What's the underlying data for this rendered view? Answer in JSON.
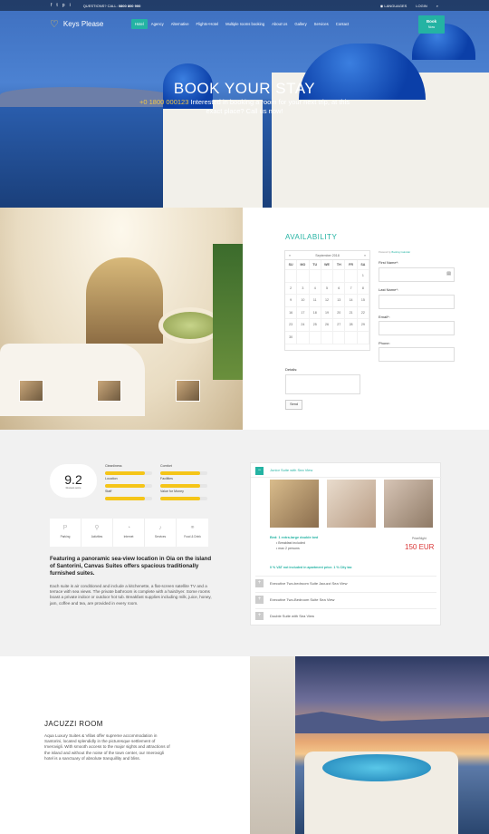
{
  "topbar": {
    "social": [
      "f",
      "t",
      "p",
      "i"
    ],
    "question": "QUESTIONS? CALL:",
    "phone": "0800 800 900",
    "languages": "LANGUAGES",
    "login": "LOGIN"
  },
  "brand": {
    "name": "Keys Please",
    "logo_icon": "heart-key-icon"
  },
  "nav": {
    "items": [
      "Hotel",
      "Agency",
      "Alternative",
      "Flights+Hotel",
      "Multiple rooms booking",
      "About Us",
      "Gallery",
      "Services",
      "Contact"
    ],
    "active": "Hotel",
    "book_now": [
      "Book",
      "Now"
    ]
  },
  "hero": {
    "title": "BOOK YOUR STAY",
    "phone": "+0 1800 000123",
    "subtitle": "Interested in booking a room for your next trip, at this exact place? Call us now!"
  },
  "availability": {
    "title": "AVAILABILITY",
    "powered": "Powered by",
    "powered_brand": "Booking Calendar",
    "month": "September 2018",
    "days": [
      "SU",
      "MO",
      "TU",
      "WE",
      "TH",
      "FR",
      "SA"
    ],
    "dates": [
      "",
      "",
      "",
      "",
      "",
      "",
      "1",
      "2",
      "3",
      "4",
      "5",
      "6",
      "7",
      "8",
      "9",
      "10",
      "11",
      "12",
      "13",
      "14",
      "15",
      "16",
      "17",
      "18",
      "19",
      "20",
      "21",
      "22",
      "23",
      "24",
      "25",
      "26",
      "27",
      "28",
      "29",
      "30",
      "",
      "",
      "",
      "",
      "",
      ""
    ],
    "fields": [
      "First Name*:",
      "Last Name*:",
      "Email*:",
      "Phone:"
    ],
    "details_label": "Details:",
    "send": "Send"
  },
  "review": {
    "score": "9.2",
    "score_label": "Reviews score",
    "categories": [
      {
        "name": "Cleanliness",
        "fill": 0.85
      },
      {
        "name": "Comfort",
        "fill": 0.85
      },
      {
        "name": "Location",
        "fill": 0.85
      },
      {
        "name": "Facilities",
        "fill": 0.85
      },
      {
        "name": "Staff",
        "fill": 0.85
      },
      {
        "name": "Value for Money",
        "fill": 0.85
      }
    ],
    "amenities": [
      {
        "label": "Parking",
        "icon": "parking-icon"
      },
      {
        "label": "Activities",
        "icon": "bike-icon"
      },
      {
        "label": "Internet",
        "icon": "wifi-icon"
      },
      {
        "label": "Services",
        "icon": "bell-icon"
      },
      {
        "label": "Food & Drink",
        "icon": "cutlery-icon"
      }
    ],
    "feature": "Featuring a panoramic sea-view location in Oia on the island of Santorini, Canvas Suites offers spacious traditionally furnished suites.",
    "description": "Each suite is air conditioned and include a kitchenette, a flat-screen satellite TV and a terrace with sea views. The private bathroom is complete with a hairdryer. Some rooms boast a private indoor or outdoor hot tub. Breakfast supplies including milk, juice, honey, jam, coffee and tea, are provided in every room."
  },
  "suites": {
    "open_title": "Junior Suite with Sea View",
    "bed": "Bed: 1 extra-large double bed",
    "bullets": [
      "Breakfast included",
      "max 2 persons"
    ],
    "price_per": "Price/Night",
    "price": "150 EUR",
    "vat": "0 % VAT not included in apartment price. 1 % City tax",
    "others": [
      "Executive Two-bedroom Suite Jacuzzi Sea View",
      "Executive Two-Bedroom Suite Sea View",
      "Double Suite with Sea View"
    ]
  },
  "jacuzzi": {
    "title": "JACUZZI ROOM",
    "text": "Aqua Luxury Suites & Villas offer supreme accommodation in Santorini, located splendidly in the picturesque settlement of Imerovigli. With smooth access to the major sights and attractions of the island and without the noise of the town center, our Imerovigli hotel is a sanctuary of absolute tranquillity and bliss."
  }
}
